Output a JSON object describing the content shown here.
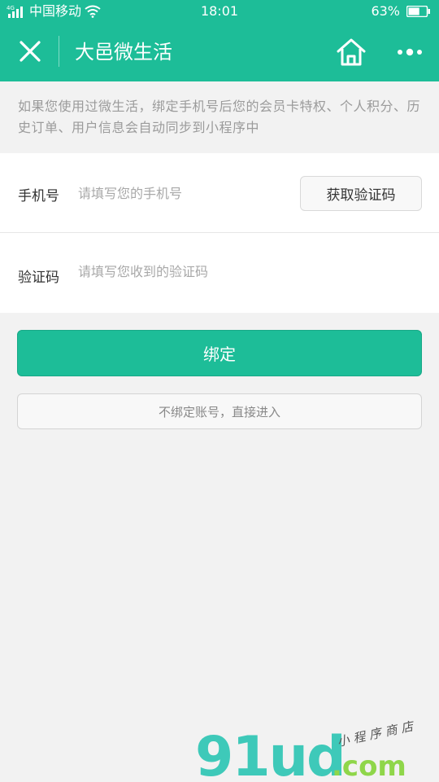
{
  "status_bar": {
    "network_type": "4G",
    "carrier": "中国移动",
    "time": "18:01",
    "battery": "63%",
    "battery_level": 0.63
  },
  "nav": {
    "title": "大邑微生活",
    "close_icon": "close-icon",
    "home_icon": "home-icon",
    "more_icon": "more-dots-icon"
  },
  "notice": {
    "text": "如果您使用过微生活，绑定手机号后您的会员卡特权、个人积分、历史订单、用户信息会自动同步到小程序中"
  },
  "form": {
    "phone": {
      "label": "手机号",
      "placeholder": "请填写您的手机号",
      "value": "",
      "get_code_label": "获取验证码"
    },
    "code": {
      "label": "验证码",
      "placeholder": "请填写您收到的验证码",
      "value": ""
    }
  },
  "actions": {
    "bind_label": "绑定",
    "skip_label": "不绑定账号，直接进入"
  },
  "watermark": {
    "logo": "91ud",
    "domain": ".com",
    "tagline": "小程序商店"
  },
  "colors": {
    "primary": "#1dbd98",
    "background": "#f2f2f2",
    "watermark_teal": "#3ec9b9",
    "watermark_green": "#8fd64a"
  }
}
